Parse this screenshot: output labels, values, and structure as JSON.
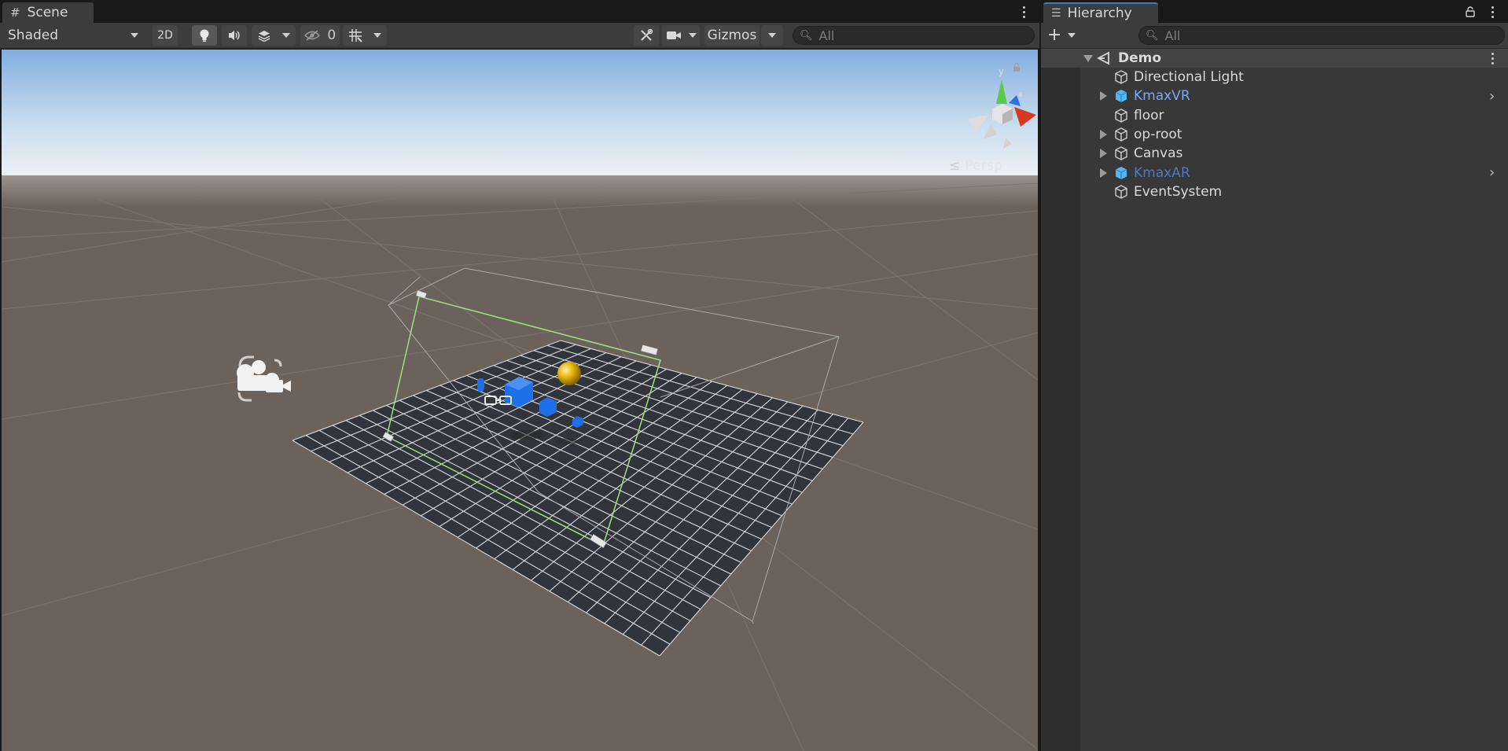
{
  "scene_panel": {
    "tab_label": "Scene",
    "tab_icon": "grid-icon",
    "toolbar": {
      "draw_mode": "Shaded",
      "mode_2d": "2D",
      "hidden_count": "0",
      "gizmos_label": "Gizmos",
      "search_placeholder": "All"
    },
    "viewport": {
      "projection_label": "Persp",
      "axis_y_label": "y",
      "axis_x_label": "x",
      "sky_color": "#8fb8e6",
      "ground_color": "#6b625b",
      "floor_color": "#31343a",
      "selection_color": "#9be37d",
      "object_color": "#1e6fe8",
      "sphere_color": "#e6b40a"
    }
  },
  "hierarchy_panel": {
    "tab_label": "Hierarchy",
    "search_placeholder": "All",
    "scene_name": "Demo",
    "items": [
      {
        "label": "Directional Light",
        "expandable": false,
        "prefab": false,
        "has_chevron": false
      },
      {
        "label": "KmaxVR",
        "expandable": true,
        "prefab": true,
        "has_chevron": true
      },
      {
        "label": "floor",
        "expandable": false,
        "prefab": false,
        "has_chevron": false
      },
      {
        "label": "op-root",
        "expandable": true,
        "prefab": false,
        "has_chevron": false
      },
      {
        "label": "Canvas",
        "expandable": true,
        "prefab": false,
        "has_chevron": false
      },
      {
        "label": "KmaxAR",
        "expandable": true,
        "prefab": true,
        "has_chevron": true,
        "inactive": true
      },
      {
        "label": "EventSystem",
        "expandable": false,
        "prefab": false,
        "has_chevron": false
      }
    ]
  }
}
